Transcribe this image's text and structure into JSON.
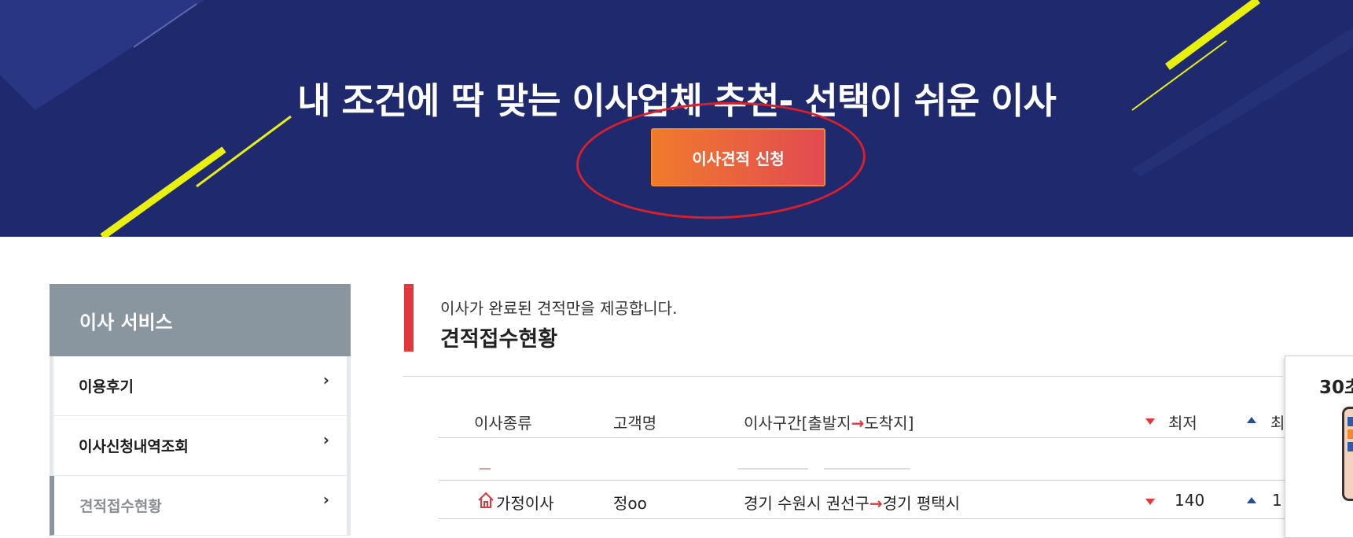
{
  "banner": {
    "title": "내 조건에 딱 맞는 이사업체 추천- 선택이 쉬운 이사",
    "cta_label": "이사견적 신청",
    "background_color": "#1f2a6e",
    "accent_color": "#e8f00c"
  },
  "sidebar": {
    "heading": "이사 서비스",
    "items": [
      {
        "label": "이용후기",
        "active": false
      },
      {
        "label": "이사신청내역조회",
        "active": false
      },
      {
        "label": "견적접수현황",
        "active": true
      }
    ]
  },
  "main": {
    "notice": "이사가 완료된 견적만을 제공합니다.",
    "title": "견적접수현황",
    "table": {
      "headers": {
        "type": "이사종류",
        "customer": "고객명",
        "route_prefix": "이사구간[출발지",
        "route_suffix": "도착지]",
        "min": "최저",
        "max": "최"
      },
      "rows": [
        {
          "type": "가정이사",
          "customer": "정oo",
          "from": "경기 수원시 권선구",
          "to": "경기 평택시",
          "min": "140",
          "max": "1"
        }
      ]
    }
  },
  "widget": {
    "title": "30초"
  }
}
